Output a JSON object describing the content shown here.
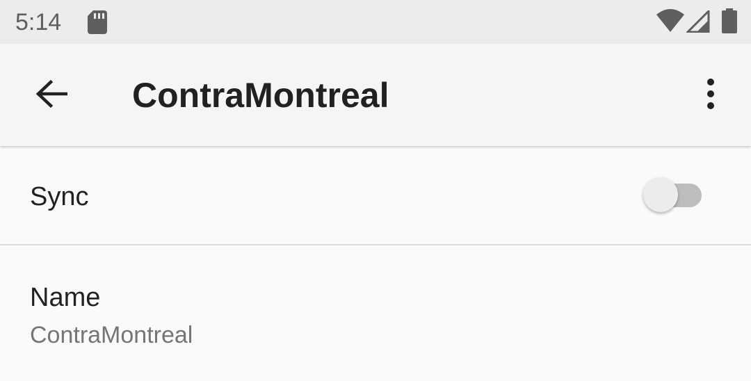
{
  "status_bar": {
    "time": "5:14",
    "icons": [
      "sd-card-icon",
      "wifi-icon",
      "cell-signal-icon",
      "battery-icon"
    ]
  },
  "app_bar": {
    "title": "ContraMontreal",
    "icons": [
      "back-arrow-icon",
      "more-vert-icon"
    ]
  },
  "settings": {
    "sync": {
      "label": "Sync",
      "enabled": false
    },
    "name": {
      "label": "Name",
      "value": "ContraMontreal"
    }
  },
  "colors": {
    "status_bar_bg": "#ececec",
    "app_bar_bg": "#f5f5f5",
    "page_bg": "#fafafa",
    "primary_text": "#212121",
    "secondary_text": "#757575",
    "switch_track_off": "#bdbdbd",
    "switch_thumb_off": "#ececec"
  }
}
